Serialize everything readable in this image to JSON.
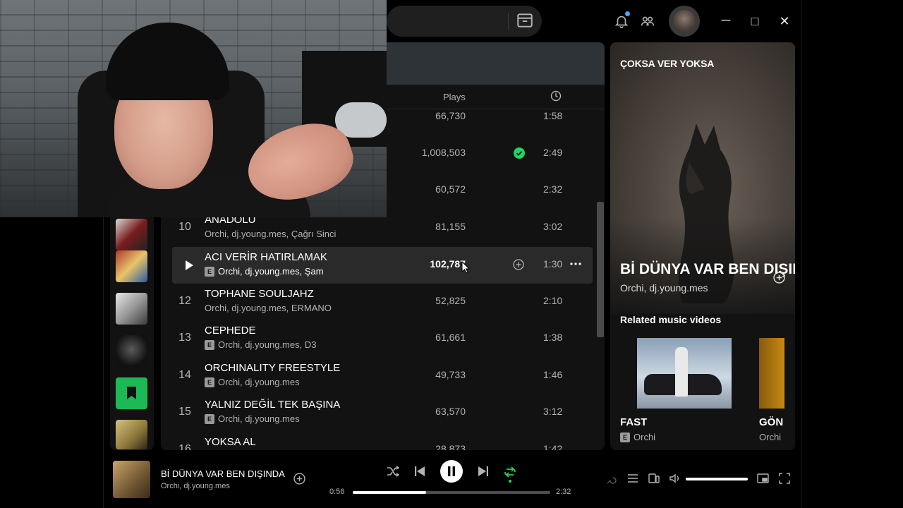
{
  "window": {
    "minimize": "─",
    "maximize": "□",
    "close": "✕"
  },
  "icons": {
    "browse": "browse-icon",
    "notifications": "bell-icon",
    "friends": "friends-icon",
    "play": "play-icon",
    "clock": "clock-icon",
    "add": "plus-circle-icon",
    "more": "more-icon"
  },
  "colors": {
    "accent": "#1ed760",
    "background": "#121212",
    "highlight_row": "#2a2a2a",
    "notification_dot": "#4aa3ff"
  },
  "tracklist": {
    "header": {
      "plays": "Plays"
    },
    "rows": [
      {
        "num": "",
        "title": "",
        "artists": "",
        "explicit": false,
        "plays": "66,730",
        "duration": "1:58",
        "saved": false
      },
      {
        "num": "",
        "title": "",
        "artists": "",
        "explicit": false,
        "plays": "1,008,503",
        "duration": "2:49",
        "saved": true
      },
      {
        "num": "",
        "title": "",
        "artists": "",
        "explicit": false,
        "plays": "60,572",
        "duration": "2:32",
        "saved": false
      },
      {
        "num": "10",
        "title": "ANADOLU",
        "artists": "Orchi, dj.young.mes, Çağrı Sinci",
        "explicit": false,
        "plays": "81,155",
        "duration": "3:02",
        "saved": false
      },
      {
        "num": "",
        "title": "ACI VERİR HATIRLAMAK",
        "artists": "Orchi, dj.young.mes, Şam",
        "explicit": true,
        "plays": "102,787",
        "duration": "1:30",
        "saved": false,
        "hovered": true
      },
      {
        "num": "12",
        "title": "TOPHANE SOULJAHZ",
        "artists": "Orchi, dj.young.mes, ERMANO",
        "explicit": false,
        "plays": "52,825",
        "duration": "2:10",
        "saved": false
      },
      {
        "num": "13",
        "title": "CEPHEDE",
        "artists": "Orchi, dj.young.mes, D3",
        "explicit": true,
        "plays": "61,661",
        "duration": "1:38",
        "saved": false
      },
      {
        "num": "14",
        "title": "ORCHINALITY FREESTYLE",
        "artists": "Orchi, dj.young.mes",
        "explicit": true,
        "plays": "49,733",
        "duration": "1:46",
        "saved": false
      },
      {
        "num": "15",
        "title": "YALNIZ DEĞİL TEK BAŞINA",
        "artists": "Orchi, dj.young.mes",
        "explicit": true,
        "plays": "63,570",
        "duration": "3:12",
        "saved": false
      },
      {
        "num": "16",
        "title": "YOKSA AL",
        "artists": "",
        "explicit": false,
        "plays": "28,873",
        "duration": "1:42",
        "saved": false
      }
    ]
  },
  "now_playing_view": {
    "context_title": "ÇOKSA VER YOKSA",
    "song_title": "Bİ DÜNYA VAR BEN DIŞINDA",
    "artists": "Orchi, dj.young.mes",
    "related_heading": "Related music videos",
    "videos": [
      {
        "title": "FAST",
        "artist": "Orchi",
        "explicit": true
      },
      {
        "title": "GÖN",
        "artist": "Orchi",
        "explicit": false
      }
    ]
  },
  "player": {
    "title": "Bİ DÜNYA VAR BEN DIŞINDA",
    "artists": "Orchi, dj.young.mes",
    "current_time": "0:56",
    "total_time": "2:32",
    "progress": 0.37,
    "volume": 1.0,
    "shuffle": true,
    "repeat": true,
    "is_playing": true
  }
}
